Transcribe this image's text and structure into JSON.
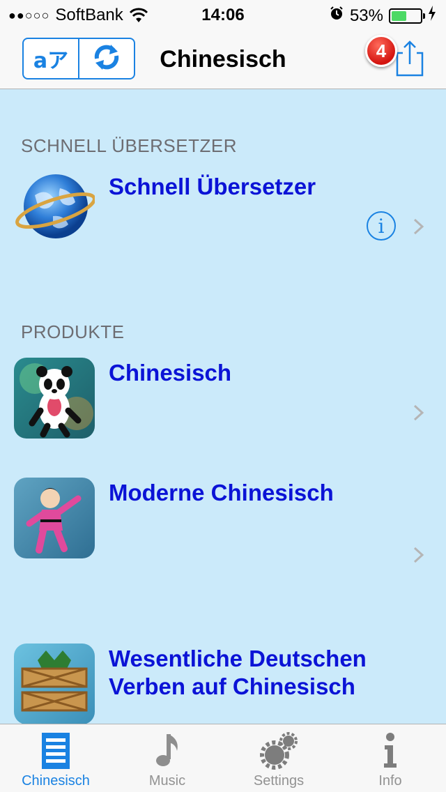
{
  "status_bar": {
    "signal": "●●○○○",
    "carrier": "SoftBank",
    "time": "14:06",
    "battery_text": "53%",
    "battery_level": 0.53
  },
  "nav": {
    "title": "Chinesisch",
    "badge_count": "4",
    "translate_icon_text": "aア"
  },
  "sections": [
    {
      "header": "SCHNELL ÜBERSETZER",
      "items": [
        {
          "title": "Schnell Übersetzer",
          "icon": "globe-icon"
        }
      ]
    },
    {
      "header": "PRODUKTE",
      "items": [
        {
          "title": "Chinesisch",
          "icon": "panda-app-icon"
        },
        {
          "title": "Moderne Chinesisch",
          "icon": "kungfu-girl-app-icon"
        },
        {
          "title_line1": "Wesentliche Deutschen",
          "title_line2": "Verben auf Chinesisch",
          "icon": "crate-app-icon"
        }
      ]
    }
  ],
  "tabs": [
    {
      "label": "Chinesisch",
      "icon": "list-icon",
      "active": true
    },
    {
      "label": "Music",
      "icon": "music-note-icon",
      "active": false
    },
    {
      "label": "Settings",
      "icon": "gears-icon",
      "active": false
    },
    {
      "label": "Info",
      "icon": "info-icon",
      "active": false
    }
  ],
  "colors": {
    "accent": "#1a82e2",
    "item_title": "#0b13d6",
    "background": "#cbeafa",
    "badge": "#d4140f"
  }
}
